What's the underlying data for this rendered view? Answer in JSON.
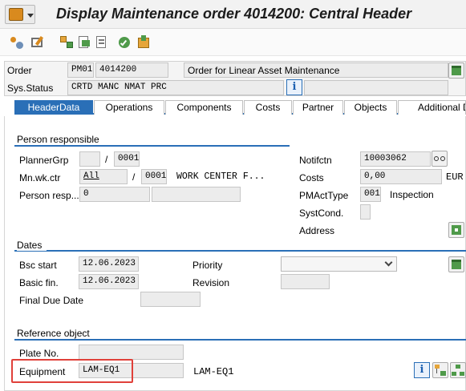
{
  "title": "Display Maintenance order 4014200: Central Header",
  "icons": {
    "menu": "sap-menu-icon",
    "toolbar": [
      "change-display-icon",
      "edit-icon",
      "components-icon",
      "operations-icon",
      "document-icon",
      "release-icon",
      "export-icon"
    ]
  },
  "header": {
    "order_label": "Order",
    "order_type": "PM01",
    "order_number": "4014200",
    "order_description": "Order for Linear Asset Maintenance",
    "status_label": "Sys.Status",
    "status_value": "CRTD MANC NMAT PRC",
    "info_glyph": "i"
  },
  "tabs": [
    {
      "label": "HeaderData",
      "active": true
    },
    {
      "label": "Operations",
      "active": false
    },
    {
      "label": "Components",
      "active": false
    },
    {
      "label": "Costs",
      "active": false
    },
    {
      "label": "Partner",
      "active": false
    },
    {
      "label": "Objects",
      "active": false
    },
    {
      "label": "Additional D",
      "active": false
    }
  ],
  "person_responsible": {
    "title": "Person responsible",
    "planner_label": "PlannerGrp",
    "planner_value": "",
    "planner_plant": "0001",
    "workctr_label": "Mn.wk.ctr",
    "workctr_value": "All",
    "workctr_plant": "0001",
    "workctr_desc": "WORK CENTER F...",
    "person_label": "Person resp...",
    "person_value": "0",
    "person_name": "",
    "separator": "/"
  },
  "notification": {
    "notif_label": "Notifctn",
    "notif_value": "10003062",
    "costs_label": "Costs",
    "costs_value": "0,00",
    "currency": "EUR",
    "pmact_label": "PMActType",
    "pmact_code": "001",
    "pmact_text": "Inspection",
    "syst_label": "SystCond.",
    "syst_value": "",
    "address_label": "Address"
  },
  "dates": {
    "title": "Dates",
    "bsc_start_label": "Bsc start",
    "bsc_start_value": "12.06.2023",
    "basic_fin_label": "Basic fin.",
    "basic_fin_value": "12.06.2023",
    "final_due_label": "Final Due Date",
    "final_due_value": "",
    "priority_label": "Priority",
    "priority_value": "",
    "revision_label": "Revision",
    "revision_value": ""
  },
  "reference": {
    "title": "Reference object",
    "plate_label": "Plate No.",
    "plate_value": "",
    "equipment_label": "Equipment",
    "equipment_value": "LAM-EQ1",
    "equipment_desc": "LAM-EQ1"
  },
  "colors": {
    "accent": "#2a6fb7",
    "highlight": "#e0403a",
    "field_bg": "#ececec"
  }
}
